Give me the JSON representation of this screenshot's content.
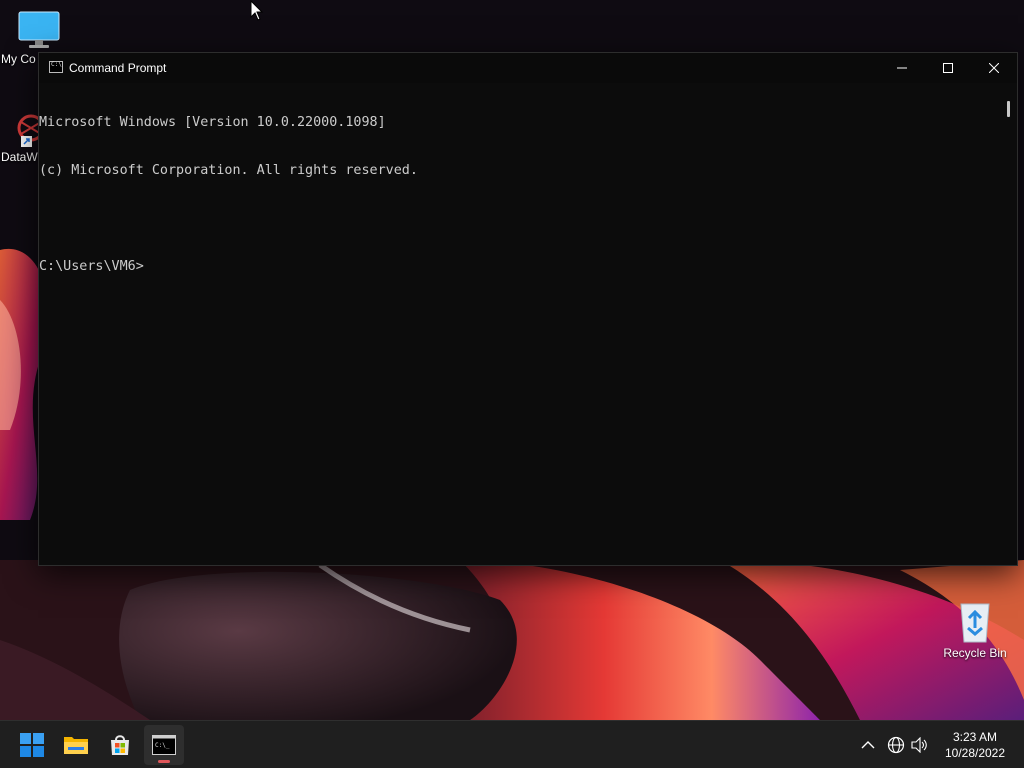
{
  "desktop": {
    "icons": [
      {
        "label": "My Co"
      },
      {
        "label": "DataW"
      },
      {
        "label": "Recycle Bin"
      }
    ]
  },
  "window": {
    "title": "Command Prompt",
    "console_lines": [
      "Microsoft Windows [Version 10.0.22000.1098]",
      "(c) Microsoft Corporation. All rights reserved.",
      "",
      "C:\\Users\\VM6>"
    ]
  },
  "taskbar": {
    "apps": [
      {
        "icon": "windows-start-icon"
      },
      {
        "icon": "file-explorer-icon"
      },
      {
        "icon": "microsoft-store-icon"
      },
      {
        "icon": "command-prompt-icon",
        "active": true
      }
    ],
    "tray": [
      {
        "icon": "chevron-up-icon"
      },
      {
        "icon": "network-globe-icon"
      },
      {
        "icon": "volume-icon"
      }
    ],
    "time": "3:23 AM",
    "date": "10/28/2022"
  },
  "colors": {
    "console_bg": "#0c0c0c",
    "console_text": "#cccccc",
    "taskbar_bg": "#1f1f1f",
    "active_indicator": "#e0575b"
  }
}
